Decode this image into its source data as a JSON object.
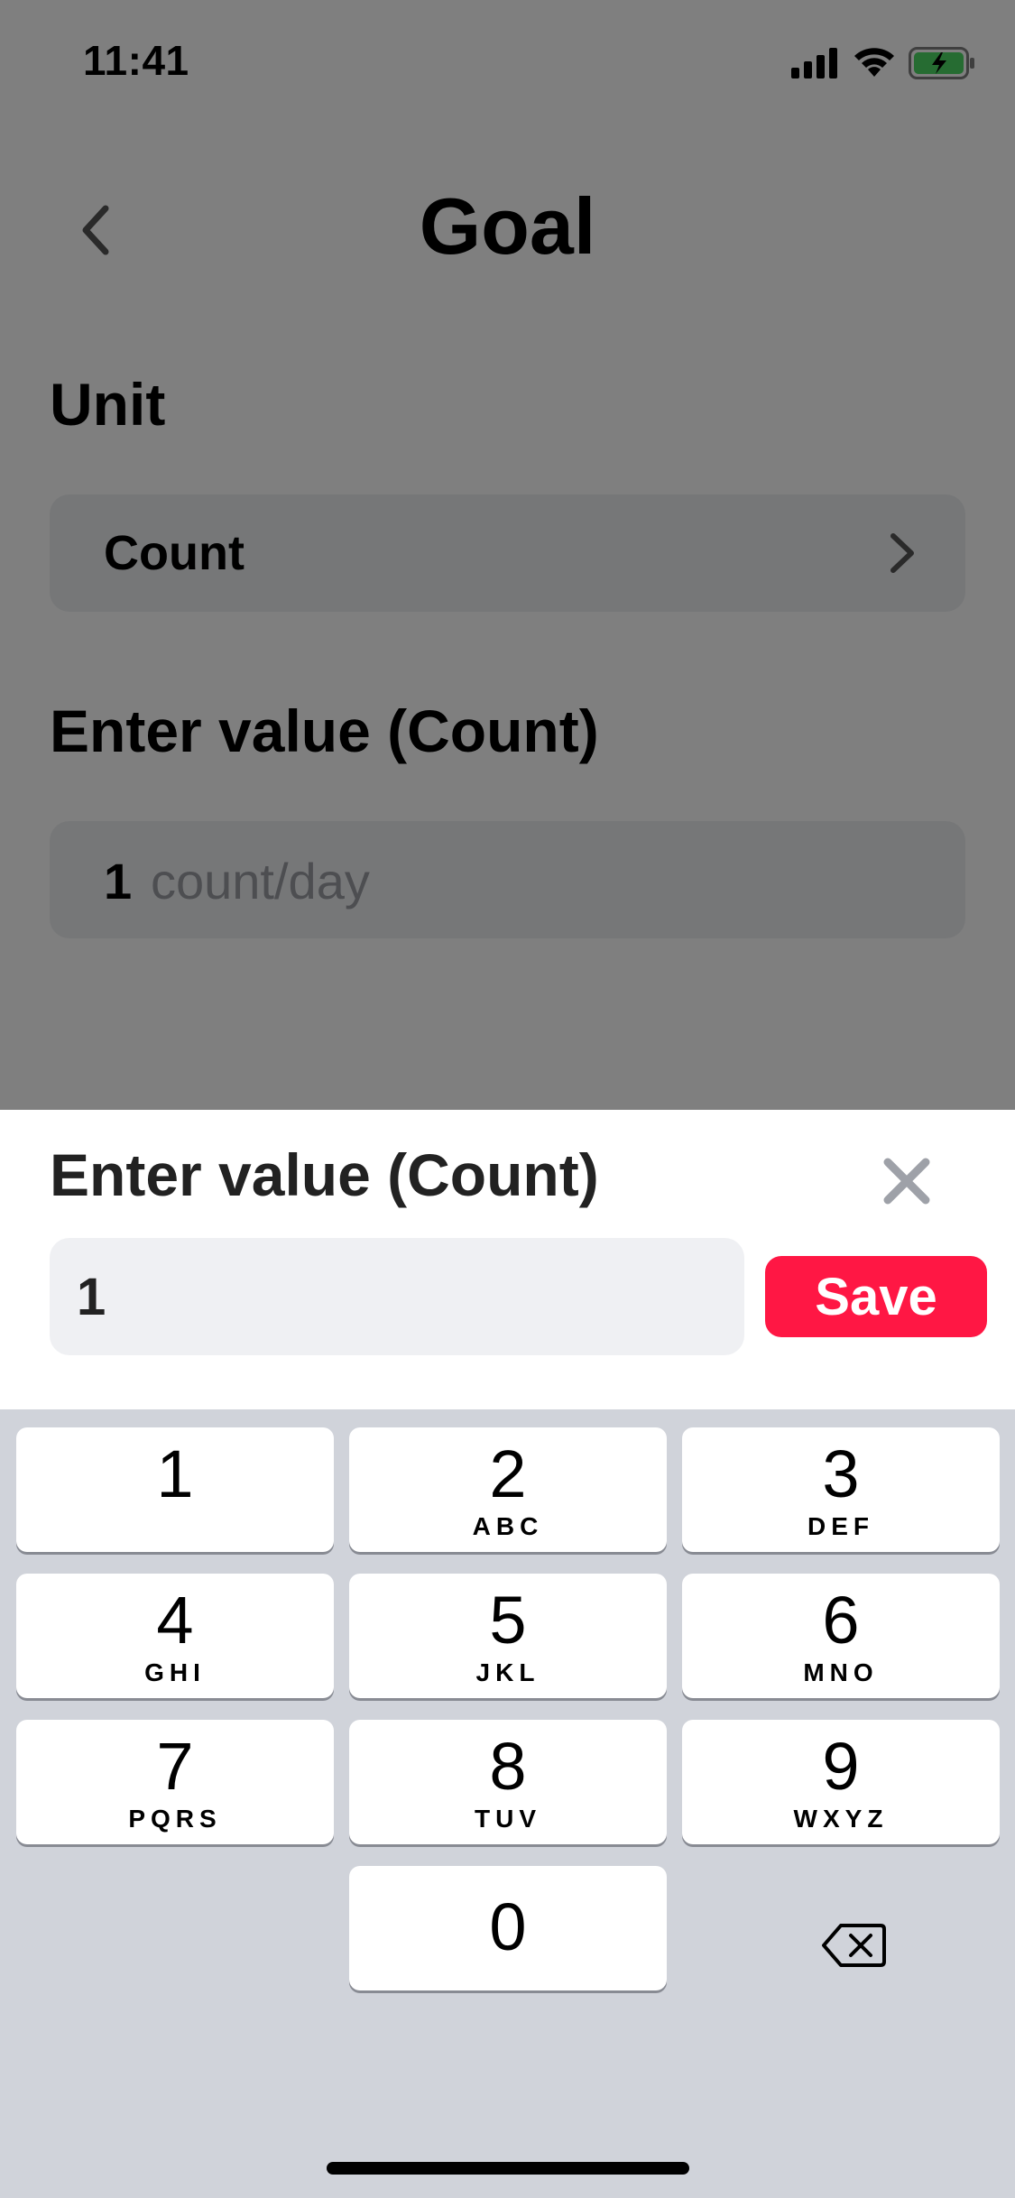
{
  "status_bar": {
    "time": "11:41",
    "icons": [
      "cellular-signal-icon",
      "wifi-icon",
      "battery-charging-icon"
    ],
    "battery_color": "#4cd964"
  },
  "nav": {
    "back_icon": "chevron-left-icon",
    "title": "Goal"
  },
  "unit_section": {
    "label": "Unit",
    "value": "Count",
    "chevron_icon": "chevron-right-icon"
  },
  "value_section": {
    "label": "Enter value (Count)",
    "value": "1",
    "suffix": "count/day"
  },
  "sheet": {
    "title": "Enter value (Count)",
    "close_icon": "close-icon",
    "input_value": "1",
    "save_label": "Save",
    "save_color": "#ff1744"
  },
  "keypad": {
    "keys": [
      {
        "digit": "1",
        "letters": ""
      },
      {
        "digit": "2",
        "letters": "ABC"
      },
      {
        "digit": "3",
        "letters": "DEF"
      },
      {
        "digit": "4",
        "letters": "GHI"
      },
      {
        "digit": "5",
        "letters": "JKL"
      },
      {
        "digit": "6",
        "letters": "MNO"
      },
      {
        "digit": "7",
        "letters": "PQRS"
      },
      {
        "digit": "8",
        "letters": "TUV"
      },
      {
        "digit": "9",
        "letters": "WXYZ"
      },
      {
        "digit": "0",
        "letters": ""
      }
    ],
    "delete_icon": "backspace-icon"
  }
}
